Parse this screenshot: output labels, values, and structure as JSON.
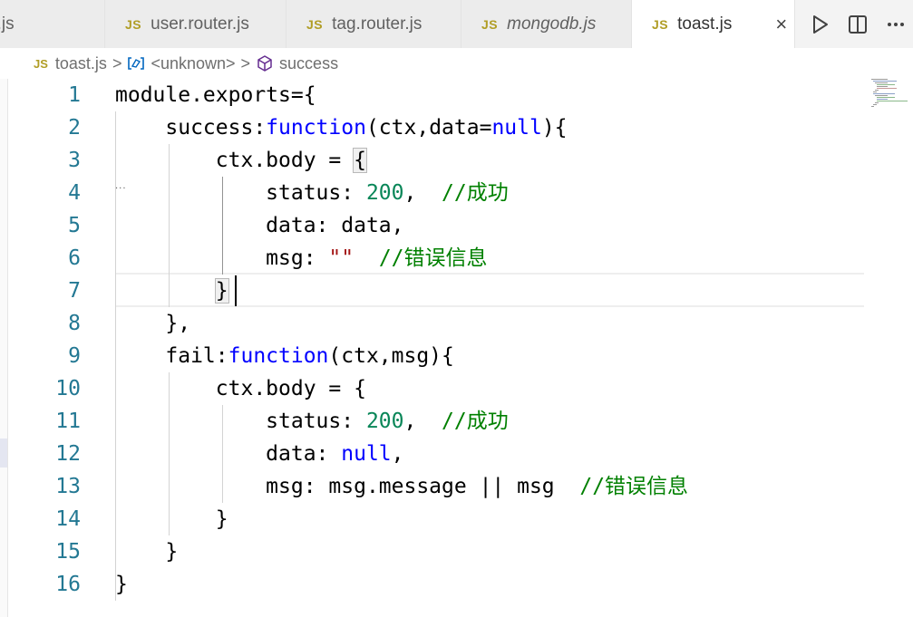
{
  "tabs": [
    {
      "label": "p.js",
      "icon": "js-file-icon",
      "italic": false,
      "active": false
    },
    {
      "label": "user.router.js",
      "icon": "js-file-icon",
      "italic": false,
      "active": false
    },
    {
      "label": "tag.router.js",
      "icon": "js-file-icon",
      "italic": false,
      "active": false
    },
    {
      "label": "mongodb.js",
      "icon": "js-file-icon",
      "italic": true,
      "active": false
    },
    {
      "label": "toast.js",
      "icon": "js-file-icon",
      "italic": false,
      "active": true
    }
  ],
  "tab_icon_text": "JS",
  "close_glyph": "×",
  "actions": [
    "run-icon",
    "split-editor-icon",
    "more-actions-icon"
  ],
  "breadcrumb": {
    "file": "toast.js",
    "sep": ">",
    "parent": "<unknown>",
    "symbol": "success"
  },
  "editor": {
    "line_numbers": [
      "1",
      "2",
      "3",
      "4",
      "5",
      "6",
      "7",
      "8",
      "9",
      "10",
      "11",
      "12",
      "13",
      "14",
      "15",
      "16"
    ],
    "cursor_line": 7
  },
  "colors": {
    "keyword": "#0000ff",
    "number": "#098658",
    "comment": "#008000",
    "string": "#a31515",
    "line_number": "#237893",
    "js_icon": "#b09d25"
  },
  "code": {
    "l1": {
      "a": "module.exports={"
    },
    "l2": {
      "a": "    success:",
      "b": "function",
      "c": "(ctx,data=",
      "d": "null",
      "e": "){"
    },
    "l3": {
      "a": "        ctx.body = ",
      "b": "{"
    },
    "l4": {
      "a": "            status: ",
      "b": "200",
      "c": ",  ",
      "d": "//成功"
    },
    "l5": {
      "a": "            data: data,"
    },
    "l6": {
      "a": "            msg: ",
      "b": "\"\"",
      "c": "  ",
      "d": "//错误信息"
    },
    "l7": {
      "a": "        ",
      "b": "}"
    },
    "l8": {
      "a": "    },"
    },
    "l9": {
      "a": "    fail:",
      "b": "function",
      "c": "(ctx,msg){"
    },
    "l10": {
      "a": "        ctx.body = {"
    },
    "l11": {
      "a": "            status: ",
      "b": "200",
      "c": ",  ",
      "d": "//成功"
    },
    "l12": {
      "a": "            data: ",
      "b": "null",
      "c": ","
    },
    "l13": {
      "a": "            msg: msg.message || msg  ",
      "b": "//错误信息"
    },
    "l14": {
      "a": "        }"
    },
    "l15": {
      "a": "    }"
    },
    "l16": {
      "a": "}"
    }
  }
}
